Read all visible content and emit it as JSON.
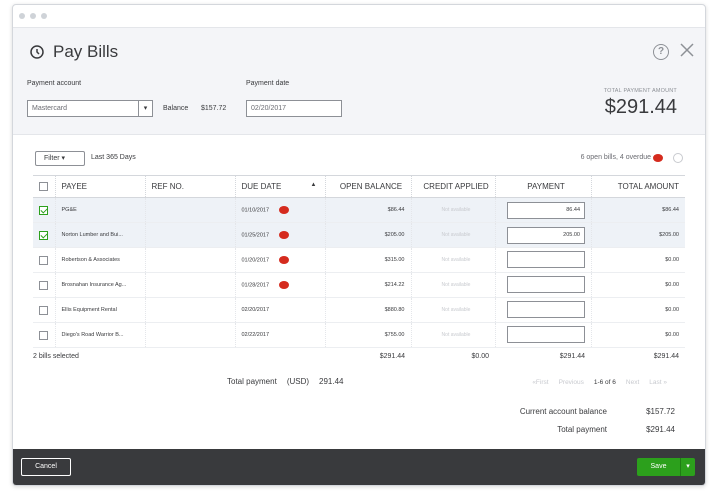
{
  "header": {
    "title": "Pay Bills",
    "payment_account_label": "Payment account",
    "payment_account_value": "Mastercard",
    "balance_label": "Balance",
    "balance_value": "$157.72",
    "payment_date_label": "Payment date",
    "payment_date_value": "02/20/2017",
    "total_payment_label": "TOTAL PAYMENT AMOUNT",
    "total_payment_value": "$291.44"
  },
  "filter": {
    "button_label": "Filter",
    "range": "Last 365 Days",
    "open_bills_text": "6 open bills, 4 overdue"
  },
  "table": {
    "columns": [
      "PAYEE",
      "REF NO.",
      "DUE DATE",
      "OPEN BALANCE",
      "CREDIT APPLIED",
      "PAYMENT",
      "TOTAL AMOUNT"
    ],
    "sort_indicator": "▲",
    "rows": [
      {
        "checked": true,
        "payee": "PG&E",
        "ref": "",
        "due": "01/10/2017",
        "overdue": true,
        "open_balance": "$86.44",
        "credit": "Not available",
        "payment": "86.44",
        "total": "$86.44"
      },
      {
        "checked": true,
        "payee": "Norton Lumber and Bui...",
        "ref": "",
        "due": "01/25/2017",
        "overdue": true,
        "open_balance": "$205.00",
        "credit": "Not available",
        "payment": "205.00",
        "total": "$205.00"
      },
      {
        "checked": false,
        "payee": "Robertson & Associates",
        "ref": "",
        "due": "01/20/2017",
        "overdue": true,
        "open_balance": "$315.00",
        "credit": "Not available",
        "payment": "",
        "total": "$0.00"
      },
      {
        "checked": false,
        "payee": "Brosnahan Insurance Ag...",
        "ref": "",
        "due": "01/28/2017",
        "overdue": true,
        "open_balance": "$214.22",
        "credit": "Not available",
        "payment": "",
        "total": "$0.00"
      },
      {
        "checked": false,
        "payee": "Ellis Equipment Rental",
        "ref": "",
        "due": "02/20/2017",
        "overdue": false,
        "open_balance": "$880.80",
        "credit": "Not available",
        "payment": "",
        "total": "$0.00"
      },
      {
        "checked": false,
        "payee": "Diego's Road Warrior B...",
        "ref": "",
        "due": "02/22/2017",
        "overdue": false,
        "open_balance": "$755.00",
        "credit": "Not available",
        "payment": "",
        "total": "$0.00"
      }
    ],
    "summary": {
      "selected": "2 bills selected",
      "open_balance": "$291.44",
      "credit": "$0.00",
      "payment": "$291.44",
      "total": "$291.44"
    }
  },
  "totals": {
    "total_payment_label": "Total payment",
    "currency": "(USD)",
    "total_payment_value": "291.44"
  },
  "pager": {
    "first": "«First",
    "previous": "Previous",
    "range": "1-6 of 6",
    "next": "Next",
    "last": "Last »"
  },
  "balance": {
    "current_label": "Current account balance",
    "current_value": "$157.72",
    "total_label": "Total payment",
    "total_value": "$291.44"
  },
  "footer": {
    "cancel_label": "Cancel",
    "save_label": "Save"
  },
  "colors": {
    "accent_green": "#2ca01c",
    "overdue_red": "#d52b1e",
    "footer_bg": "#393a3d"
  }
}
